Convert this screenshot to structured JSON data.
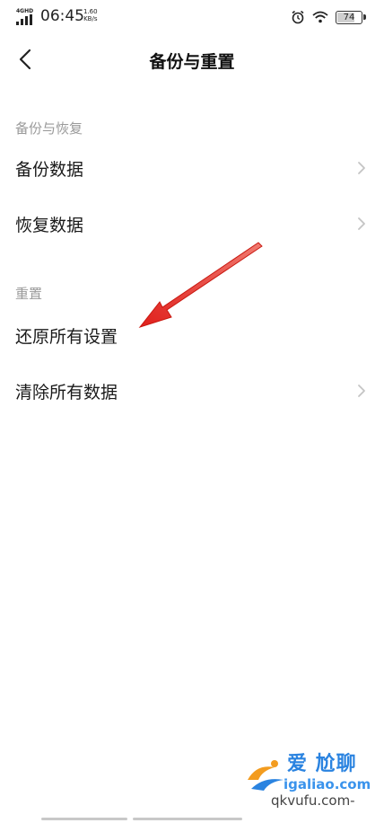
{
  "status_bar": {
    "network": "4GHD",
    "time": "06:45",
    "speed_value": "1.60",
    "speed_unit": "KB/s",
    "battery": "74",
    "battery_fraction": 0.74,
    "icons": [
      "signal-icon",
      "alarm-icon",
      "wifi-icon",
      "battery-icon"
    ]
  },
  "header": {
    "back_icon": "back-chevron-icon",
    "title": "备份与重置"
  },
  "sections": [
    {
      "label": "备份与恢复",
      "items": [
        {
          "label": "备份数据",
          "has_chevron": true
        },
        {
          "label": "恢复数据",
          "has_chevron": true
        }
      ]
    },
    {
      "label": "重置",
      "items": [
        {
          "label": "还原所有设置",
          "has_chevron": false
        },
        {
          "label": "清除所有数据",
          "has_chevron": true
        }
      ]
    }
  ],
  "annotation": {
    "type": "red-arrow",
    "color": "#e0201c"
  },
  "watermark": {
    "line1": "爱 尬聊",
    "line2": "igaliao.com",
    "line3": "qkvufu.com-"
  },
  "colors": {
    "section_label": "#9a9a9a",
    "chevron": "#c4c4c4",
    "arrow": "#e0201c"
  }
}
